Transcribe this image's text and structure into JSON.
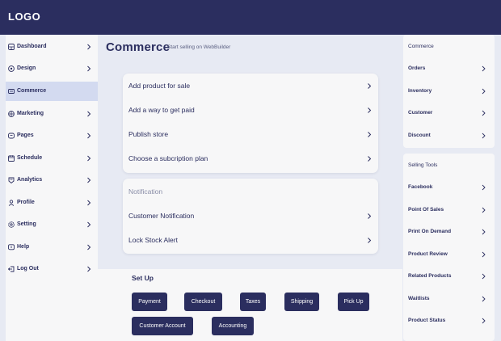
{
  "header": {
    "logo": "LOGO"
  },
  "sidebar": {
    "items": [
      {
        "label": "Dashboard",
        "icon": "dashboard-icon"
      },
      {
        "label": "Design",
        "icon": "design-icon"
      },
      {
        "label": "Commerce",
        "icon": "commerce-icon",
        "active": true
      },
      {
        "label": "Marketing",
        "icon": "marketing-icon"
      },
      {
        "label": "Pages",
        "icon": "pages-icon"
      },
      {
        "label": "Schedule",
        "icon": "schedule-icon"
      },
      {
        "label": "Analytics",
        "icon": "analytics-icon"
      },
      {
        "label": "Profile",
        "icon": "profile-icon"
      },
      {
        "label": "Setting",
        "icon": "setting-icon"
      },
      {
        "label": "Help",
        "icon": "help-icon"
      },
      {
        "label": "Log Out",
        "icon": "logout-icon"
      }
    ]
  },
  "main": {
    "title": "Commerce",
    "subtitle": "Start selling on WebBuilder",
    "tasks": [
      "Add product for sale",
      "Add a way to get paid",
      "Publish store",
      "Choose a subcription plan"
    ],
    "notification": {
      "heading": "Notification",
      "items": [
        "Customer Notification",
        "Lock Stock Alert"
      ]
    },
    "setup": {
      "title": "Set Up",
      "buttons": [
        "Payment",
        "Checkout",
        "Taxes",
        "Shipping",
        "Pick Up",
        "Customer Account",
        "Accounting"
      ]
    }
  },
  "right_panel": {
    "commerce": {
      "heading": "Commerce",
      "items": [
        "Orders",
        "Inventory",
        "Customer",
        "Discount"
      ]
    },
    "selling_tools": {
      "heading": "Selling Tools",
      "items": [
        "Facebook",
        "Point Of Sales",
        "Print On Demand",
        "Product Review",
        "Related Products",
        "Waitlists",
        "Product Status"
      ]
    }
  },
  "colors": {
    "navy": "#2b2e5f",
    "background": "#e7eaf3",
    "card": "#f7f7f8",
    "active": "#d3daf0"
  }
}
